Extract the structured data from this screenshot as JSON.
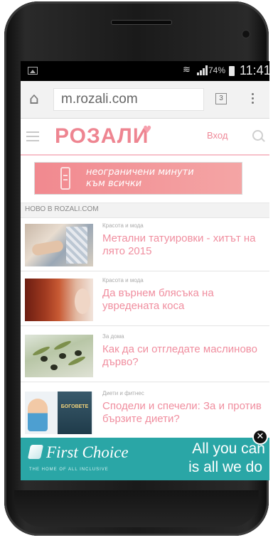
{
  "statusbar": {
    "battery_pct": "74%",
    "time": "11:41",
    "icons": [
      "image-icon",
      "wifi-icon",
      "signal-icon",
      "battery-icon"
    ]
  },
  "browser": {
    "url": "m.rozali.com",
    "tabs_count": "3",
    "icons": [
      "home-icon",
      "menu-dots-icon"
    ]
  },
  "site": {
    "logo": "РОЗАЛИ",
    "login": "Вход",
    "brand_color": "#ee8591"
  },
  "banner": {
    "text_line1": "неограничени минути",
    "text_line2": "към всички"
  },
  "section": {
    "title": "НОВО В ROZALI.COM"
  },
  "articles": [
    {
      "category": "Красота и мода",
      "title": "Метални татуировки - хитът на лято 2015"
    },
    {
      "category": "Красота и мода",
      "title": "Да върнем блясъка на увредената коса"
    },
    {
      "category": "За дома",
      "title": "Как да си отгледате маслиново дърво?"
    },
    {
      "category": "Диети и фитнес",
      "title": "Сподели и спечели: За и против бързите диети?",
      "thumb_label": "БОГОВЕТЕ"
    }
  ],
  "ad": {
    "brand": "First Choice",
    "tagline": "THE HOME OF ALL INCLUSIVE",
    "copy_line1": "All you can",
    "copy_line2": "is all we do",
    "close_label": "✕",
    "bg_color": "#2aa6a6"
  }
}
